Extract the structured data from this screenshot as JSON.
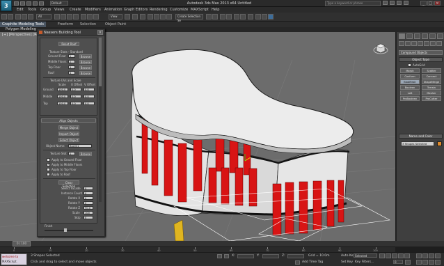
{
  "app": {
    "window_title": "Autodesk 3ds Max 2013 x64  Untitled",
    "workspace": "Default",
    "search_placeholder": "Type a keyword or phrase",
    "min_label": "_",
    "max_label": "□",
    "close_label": "×"
  },
  "menu": [
    "Edit",
    "Tools",
    "Group",
    "Views",
    "Create",
    "Modifiers",
    "Animation",
    "Graph Editors",
    "Rendering",
    "Customize",
    "MAXScript",
    "Help"
  ],
  "toolbar": {
    "filter_select": "All",
    "coord_select": "View",
    "named_selection": "Create Selection Se"
  },
  "ribbon": {
    "tabs": [
      "Graphite Modeling Tools",
      "Freeform",
      "Selection",
      "Object Paint"
    ],
    "sub_label": "Polygon Modeling"
  },
  "viewport": {
    "label": "[+] [Perspective] [Realistic]"
  },
  "tool_panel": {
    "title": "Nassers Building Tool",
    "close": "×",
    "reset_btn": "Reset Roof",
    "texture_slots_label": "Texture Slots - Standard",
    "slots": [
      {
        "label": "Ground Floor",
        "value": "1",
        "btn": "Browse"
      },
      {
        "label": "Middle Floors",
        "value": "2",
        "btn": "Browse"
      },
      {
        "label": "Top Floor",
        "value": "3",
        "btn": "Browse"
      },
      {
        "label": "Roof",
        "value": "4",
        "btn": "Browse"
      }
    ],
    "uv_label": "Texture UVs and Scale",
    "uv_headers": [
      "Scale",
      "U Offset",
      "V Offset"
    ],
    "uv_rows": [
      {
        "label": "Ground",
        "values": [
          "100.0",
          "0.0",
          "0.0"
        ]
      },
      {
        "label": "Middle",
        "values": [
          "100.0",
          "0.0",
          "0.0"
        ]
      },
      {
        "label": "Top",
        "values": [
          "100.0",
          "0.0",
          "0.0"
        ]
      }
    ],
    "align_header": "Align Objects",
    "merge_btn": "Merge Object",
    "import_btn": "Import Object",
    "select_btn": "Select Object",
    "object_name_label": "Object Name:",
    "object_name_value": "Box001",
    "texture_slot_label": "Texture Slot",
    "texture_slot_value": "1",
    "texture_slot_btn": "Browse",
    "apply_options": [
      {
        "label": "Apply to Ground Floor",
        "checked": false
      },
      {
        "label": "Apply to Middle Floors",
        "checked": true
      },
      {
        "label": "Apply to Top Floor",
        "checked": false
      },
      {
        "label": "Apply to Roof",
        "checked": false
      }
    ],
    "clear_btn": "Clear Selection",
    "spinners": [
      {
        "label": "Select Facade",
        "value": "0"
      },
      {
        "label": "Instance Count",
        "value": "0"
      },
      {
        "label": "Rotate X",
        "value": "0"
      },
      {
        "label": "Rotate Y",
        "value": "0"
      },
      {
        "label": "Rotate Z",
        "value": "90.0"
      },
      {
        "label": "Scale",
        "value": "100"
      },
      {
        "label": "Skip",
        "value": "0"
      }
    ],
    "finish_label": "Finish"
  },
  "command_panel": {
    "dropdown": "Compound Objects",
    "object_type_header": "Object Type",
    "autogrid": "AutoGrid",
    "buttons": [
      "Morph",
      "Scatter",
      "Conform",
      "Connect",
      "BlobMesh",
      "ShapeMerge",
      "Boolean",
      "Terrain",
      "Loft",
      "Mesher",
      "ProBoolean",
      "ProCutter"
    ],
    "active_button": "BlobMesh",
    "name_color_header": "Name and Color",
    "name_value": "3 Shapes Selected"
  },
  "timeline": {
    "frame": "0 / 100",
    "ticks": [
      "0",
      "10",
      "20",
      "30",
      "40",
      "50",
      "60",
      "70",
      "80",
      "90",
      "100"
    ]
  },
  "status": {
    "script_lines": [
      "welcome to",
      "MAXScript."
    ],
    "selection": "3 Shapes Selected",
    "prompt": "Click and drag to select and move objects",
    "x_label": "X:",
    "y_label": "Y:",
    "z_label": "Z:",
    "grid": "Grid = 10.0m",
    "auto_key": "Auto Key",
    "selected": "Selected",
    "set_key": "Set Key",
    "key_filters": "Key Filters...",
    "add_time_tag": "Add Time Tag",
    "frame_field": "0"
  },
  "colors": {
    "viewport_bg": "#6c6c6c",
    "window_red": "#d81414",
    "wall": "#e6e6e6",
    "roof": "#ededed",
    "ui_dark": "#2c2c2c"
  }
}
